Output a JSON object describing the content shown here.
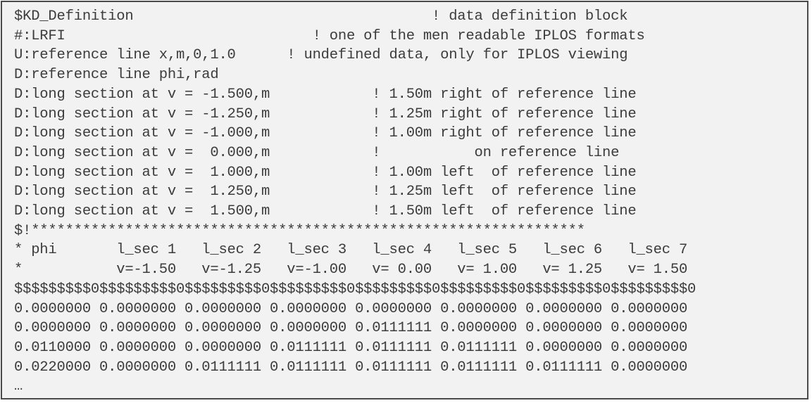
{
  "document": {
    "lines": [
      "$KD_Definition                                   ! data definition block",
      "#:LRFI                             ! one of the men readable IPLOS formats",
      "U:reference line x,m,0,1.0      ! undefined data, only for IPLOS viewing",
      "D:reference line phi,rad",
      "D:long section at v = -1.500,m            ! 1.50m right of reference line",
      "D:long section at v = -1.250,m            ! 1.25m right of reference line",
      "D:long section at v = -1.000,m            ! 1.00m right of reference line",
      "D:long section at v =  0.000,m            !           on reference line",
      "D:long section at v =  1.000,m            ! 1.00m left  of reference line",
      "D:long section at v =  1.250,m            ! 1.25m left  of reference line",
      "D:long section at v =  1.500,m            ! 1.50m left  of reference line",
      "$!*****************************************************************",
      "* phi       l_sec 1   l_sec 2   l_sec 3   l_sec 4   l_sec 5   l_sec 6   l_sec 7",
      "*           v=-1.50   v=-1.25   v=-1.00   v= 0.00   v= 1.00   v= 1.25   v= 1.50",
      "$$$$$$$$$0$$$$$$$$$0$$$$$$$$$0$$$$$$$$$0$$$$$$$$$0$$$$$$$$$0$$$$$$$$$0$$$$$$$$$0",
      "0.0000000 0.0000000 0.0000000 0.0000000 0.0000000 0.0000000 0.0000000 0.0000000",
      "0.0000000 0.0000000 0.0000000 0.0000000 0.0111111 0.0000000 0.0000000 0.0000000",
      "0.0110000 0.0000000 0.0000000 0.0111111 0.0111111 0.0111111 0.0000000 0.0000000",
      "0.0220000 0.0000000 0.0111111 0.0111111 0.0111111 0.0111111 0.0111111 0.0000000",
      "…"
    ]
  }
}
